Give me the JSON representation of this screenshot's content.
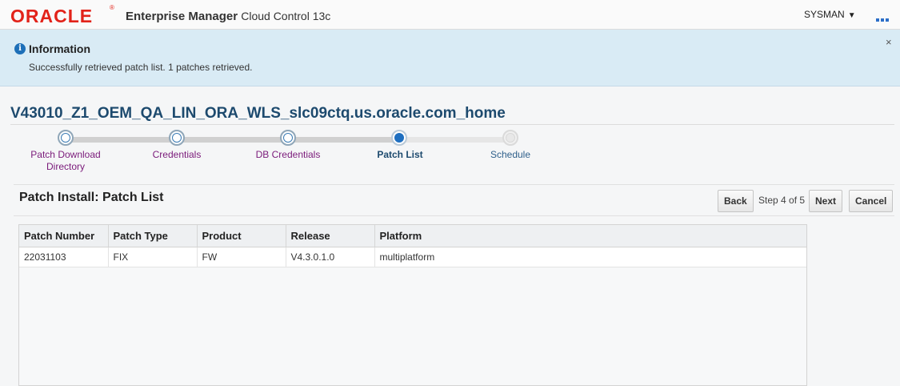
{
  "header": {
    "logo": "ORACLE",
    "logo_mark": "®",
    "product_bold": "Enterprise Manager",
    "product_light": "Cloud Control 13c",
    "user": "SYSMAN",
    "user_caret": "▼"
  },
  "info": {
    "icon": "i",
    "title": "Information",
    "message": "Successfully retrieved patch list. 1 patches retrieved.",
    "close": "×"
  },
  "target_name": "V43010_Z1_OEM_QA_LIN_ORA_WLS_slc09ctq.us.oracle.com_home",
  "train": {
    "steps": [
      {
        "label": "Patch Download\nDirectory",
        "state": "done"
      },
      {
        "label": "Credentials",
        "state": "done"
      },
      {
        "label": "DB Credentials",
        "state": "done"
      },
      {
        "label": "Patch List",
        "state": "current"
      },
      {
        "label": "Schedule",
        "state": "future"
      }
    ]
  },
  "page": {
    "title": "Patch Install: Patch List",
    "back_label": "Back",
    "step_text": "Step 4 of 5",
    "next_label": "Next",
    "cancel_label": "Cancel"
  },
  "table": {
    "columns": [
      "Patch Number",
      "Patch Type",
      "Product",
      "Release",
      "Platform"
    ],
    "rows": [
      [
        "22031103",
        "FIX",
        "FW",
        "V4.3.0.1.0",
        "multiplatform"
      ]
    ]
  },
  "colors": {
    "brand_red": "#e2231a",
    "info_bg": "#d9ebf5",
    "heading_blue": "#1d4a6e",
    "visited_step": "#7a1a7a",
    "current_step": "#1f6fc0"
  }
}
